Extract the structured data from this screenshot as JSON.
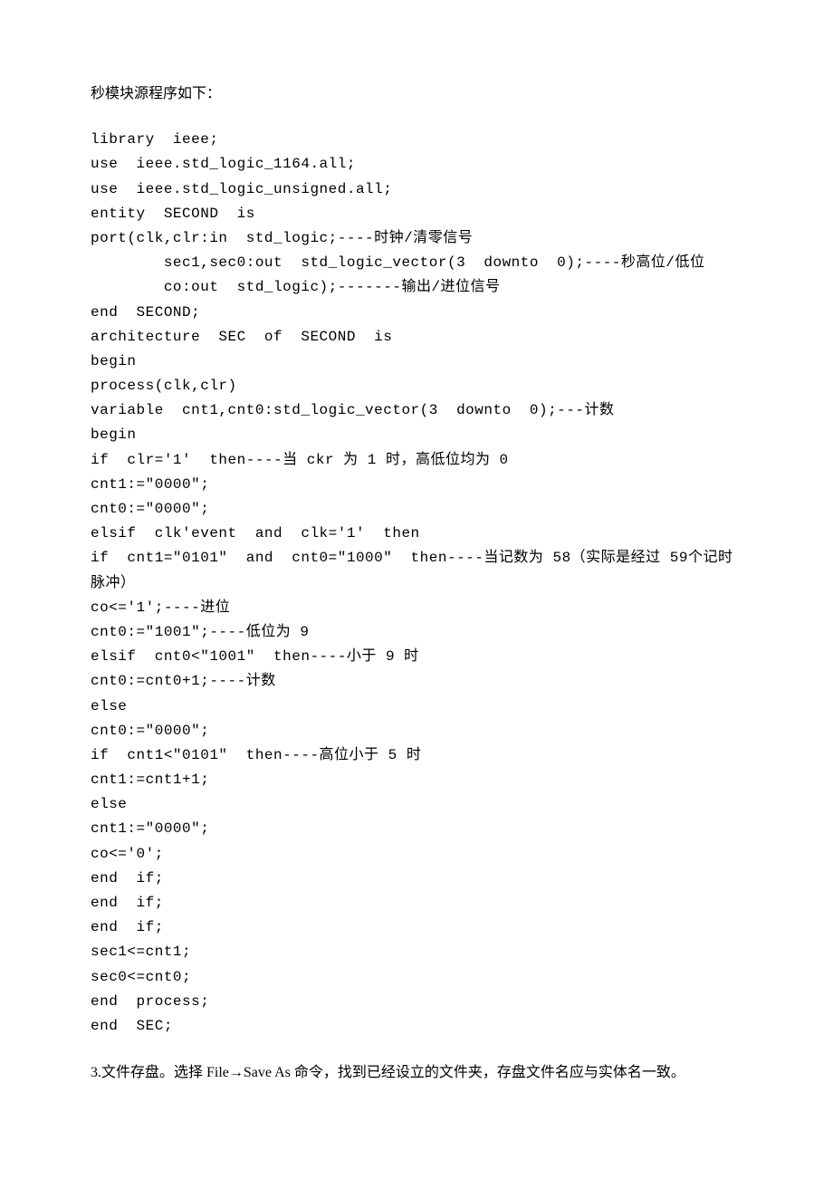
{
  "heading": "秒模块源程序如下：",
  "code": "library  ieee;\nuse  ieee.std_logic_1164.all;\nuse  ieee.std_logic_unsigned.all;\nentity  SECOND  is\nport(clk,clr:in  std_logic;----时钟/清零信号\n        sec1,sec0:out  std_logic_vector(3  downto  0);----秒高位/低位\n        co:out  std_logic);-------输出/进位信号\nend  SECOND;\narchitecture  SEC  of  SECOND  is\nbegin\nprocess(clk,clr)\nvariable  cnt1,cnt0:std_logic_vector(3  downto  0);---计数\nbegin\nif  clr='1'  then----当 ckr 为 1 时，高低位均为 0\ncnt1:=\"0000\";\ncnt0:=\"0000\";\nelsif  clk'event  and  clk='1'  then\nif  cnt1=\"0101\"  and  cnt0=\"1000\"  then----当记数为 58（实际是经过 59个记时脉冲）\nco<='1';----进位\ncnt0:=\"1001\";----低位为 9\nelsif  cnt0<\"1001\"  then----小于 9 时\ncnt0:=cnt0+1;----计数\nelse\ncnt0:=\"0000\";\nif  cnt1<\"0101\"  then----高位小于 5 时\ncnt1:=cnt1+1;\nelse\ncnt1:=\"0000\";\nco<='0';\nend  if;\nend  if;\nend  if;\nsec1<=cnt1;\nsec0<=cnt0;\nend  process;\nend  SEC;",
  "paragraph": "3.文件存盘。选择 File→Save  As 命令，找到已经设立的文件夹，存盘文件名应与实体名一致。"
}
